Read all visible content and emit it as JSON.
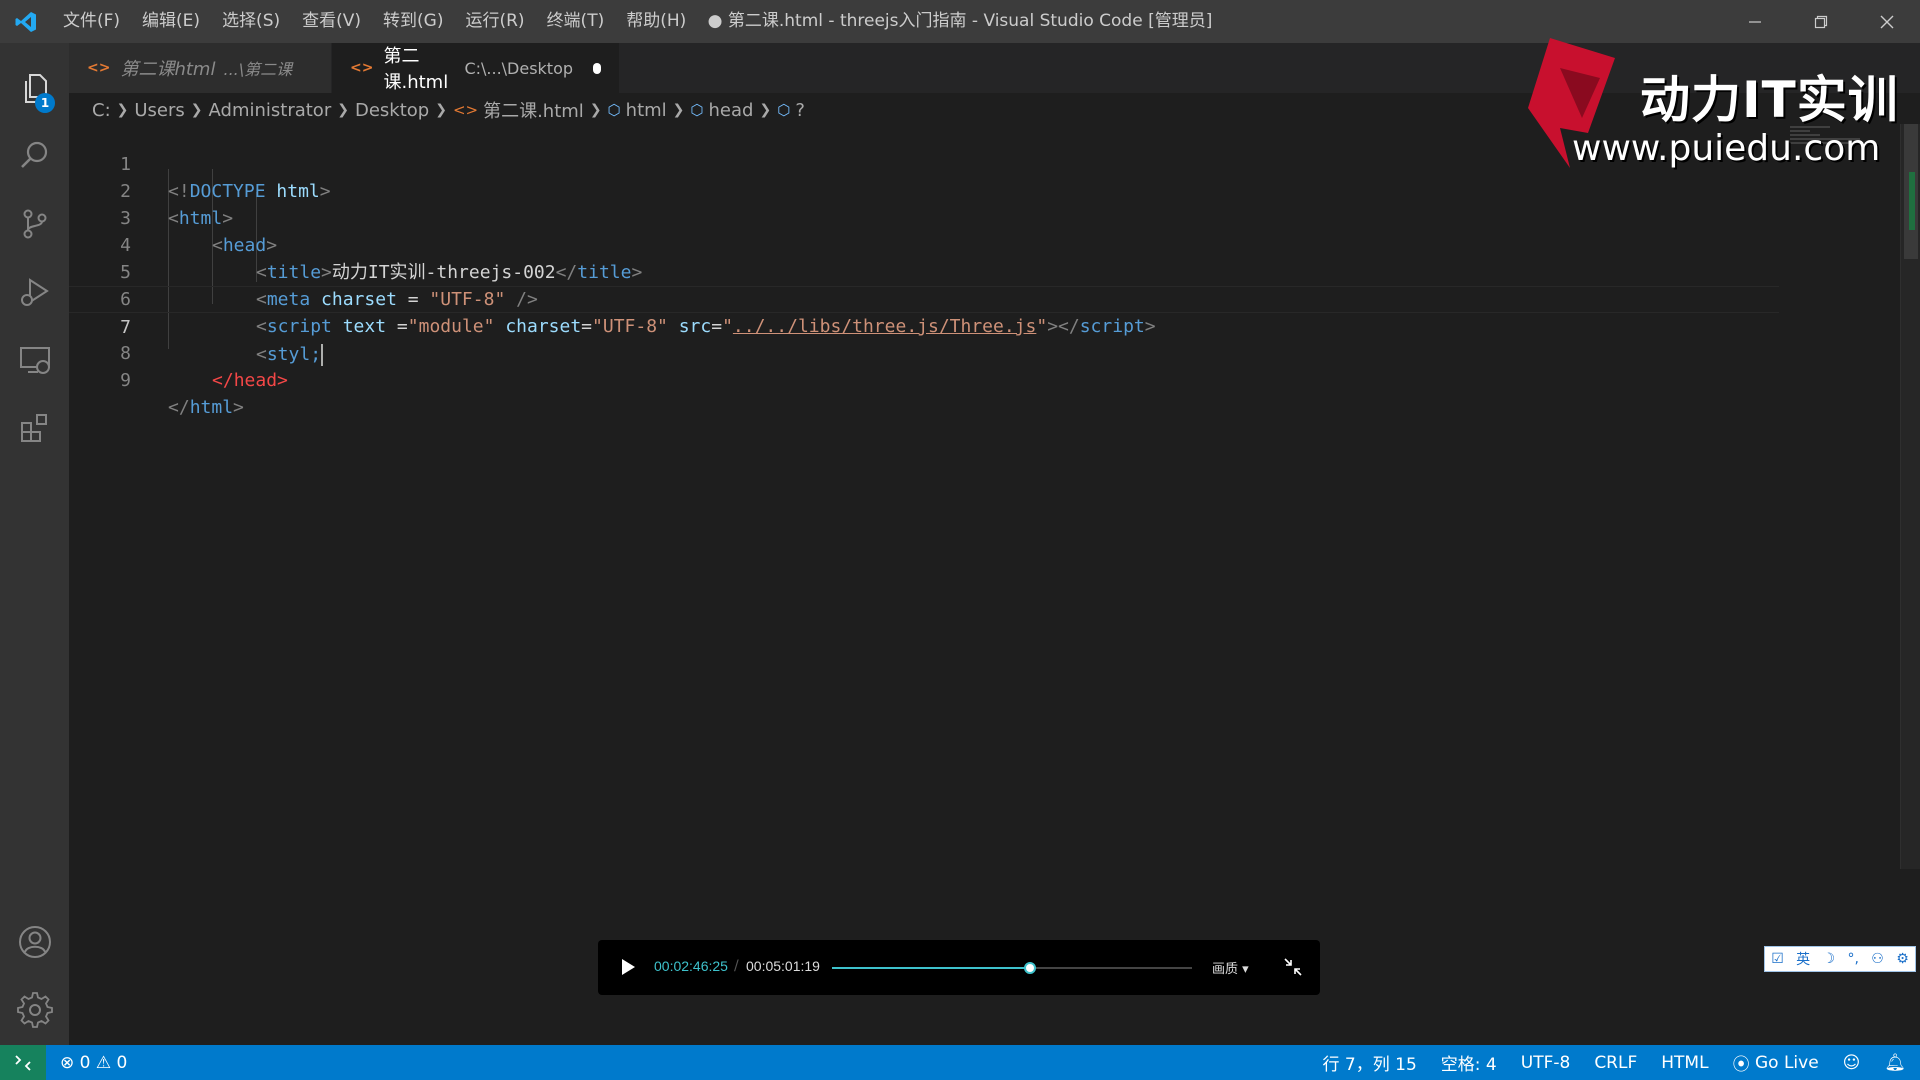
{
  "titlebar": {
    "menu": [
      "文件(F)",
      "编辑(E)",
      "选择(S)",
      "查看(V)",
      "转到(G)",
      "运行(R)",
      "终端(T)",
      "帮助(H)"
    ],
    "window_title": "● 第二课.html - threejs入门指南 - Visual Studio Code [管理员]"
  },
  "activity_bar": {
    "explorer_badge": "1",
    "icons": [
      "files-icon",
      "search-icon",
      "source-control-icon",
      "run-debug-icon",
      "remote-explorer-icon",
      "extensions-icon",
      "account-icon",
      "settings-gear-icon"
    ]
  },
  "tabs": [
    {
      "label": "第二课html",
      "description": "...\\第二课",
      "active": false
    },
    {
      "label": "第二课.html",
      "description": "C:\\...\\Desktop",
      "active": true,
      "dirty": true
    }
  ],
  "breadcrumb": {
    "items": [
      "C:",
      "Users",
      "Administrator",
      "Desktop",
      "第二课.html",
      "html",
      "head",
      "?"
    ]
  },
  "editor": {
    "line_numbers": [
      "1",
      "2",
      "3",
      "4",
      "5",
      "6",
      "7",
      "8",
      "9"
    ],
    "current_line": 7,
    "lines": {
      "l1": {
        "p1": "<!",
        "kw": "DOCTYPE",
        "sp": " ",
        "attr": "html",
        "p2": ">"
      },
      "l2": {
        "p1": "<",
        "tag": "html",
        "p2": ">"
      },
      "l3": {
        "p1": "<",
        "tag": "head",
        "p2": ">"
      },
      "l4": {
        "p1": "<",
        "tag": "title",
        "p2": ">",
        "text": "动力IT实训-threejs-002",
        "p3": "</",
        "tag2": "title",
        "p4": ">"
      },
      "l5": {
        "p1": "<",
        "tag": "meta",
        "sp1": " ",
        "attr": "charset",
        "eq": " = ",
        "val": "\"UTF-8\"",
        "p2": " />"
      },
      "l6": {
        "p1": "<",
        "tag": "script",
        "sp1": " ",
        "attr1": "text",
        "eq1": " =",
        "val1": "\"module\"",
        "sp2": " ",
        "attr2": "charset",
        "eq2": "=",
        "val2": "\"UTF-8\"",
        "sp3": " ",
        "attr3": "src",
        "eq3": "=",
        "q1": "\"",
        "link": "../../libs/three.js/Three.js",
        "q2": "\"",
        "p2": "></",
        "tag2": "script",
        "p3": ">"
      },
      "l7": {
        "p1": "<",
        "tag": "styl;"
      },
      "l8": {
        "p1": "</",
        "tag": "head",
        "p2": ">"
      },
      "l9": {
        "p1": "</",
        "tag": "html",
        "p2": ">"
      }
    }
  },
  "watermark": {
    "brand": "动力IT实训",
    "url": "www.puiedu.com"
  },
  "player": {
    "current_time": "00:02:46:25",
    "separator": "/",
    "total_time": "00:05:01:19",
    "progress": 0.55,
    "quality_label": "画质"
  },
  "ime": {
    "lang": "英"
  },
  "statusbar": {
    "errors": "0",
    "warnings": "0",
    "position": "行 7，列 15",
    "spaces": "空格: 4",
    "encoding": "UTF-8",
    "eol": "CRLF",
    "language": "HTML",
    "go_live": "Go Live"
  },
  "colors": {
    "accent": "#007acc",
    "remote": "#16825d",
    "tag": "#569cd6",
    "attr": "#9cdcfe",
    "string": "#ce9178",
    "error": "#f44747",
    "player_accent": "#3ec2cc"
  }
}
